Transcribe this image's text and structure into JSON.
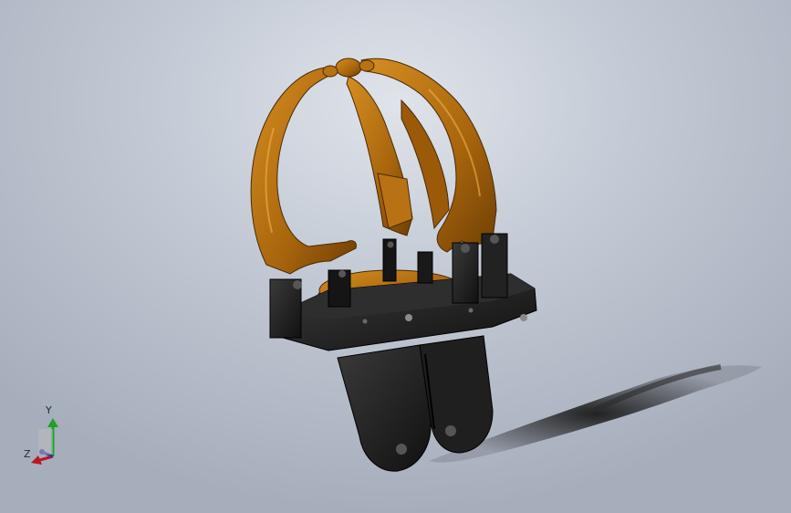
{
  "viewport": {
    "triad": {
      "y_label": "Y",
      "z_label": "Z"
    }
  },
  "colors": {
    "background_top": "#dfe3ea",
    "background_bottom": "#a6aebc",
    "orange_part": "#a8650c",
    "orange_highlight": "#d58e22",
    "black_part": "#1b1b1b",
    "shadow": "#222222",
    "axis_y": "#1fa02a",
    "axis_x": "#c0151c",
    "axis_z": "#2c3aa8"
  }
}
